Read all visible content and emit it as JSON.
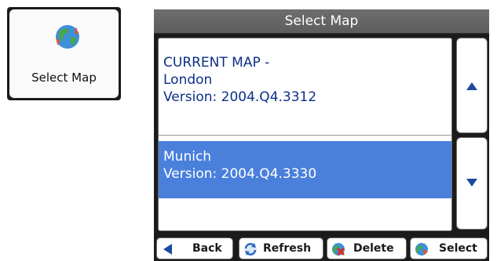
{
  "tile": {
    "label": "Select Map",
    "icon": "globe-refresh-icon"
  },
  "window": {
    "title": "Select Map"
  },
  "maps": [
    {
      "lines": [
        "CURRENT MAP -",
        "London",
        "Version:  2004.Q4.3312"
      ],
      "selected": false
    },
    {
      "lines": [
        "Munich",
        "Version:  2004.Q4.3330"
      ],
      "selected": true
    }
  ],
  "scroll": {
    "up_icon": "arrow-up-icon",
    "down_icon": "arrow-down-icon"
  },
  "toolbar": {
    "back_label": "Back",
    "refresh_label": "Refresh",
    "delete_label": "Delete",
    "select_label": "Select"
  },
  "colors": {
    "selection": "#4a80dc",
    "item_text": "#0d2f86",
    "title_bar": "#636363",
    "arrow": "#1c4aa0"
  }
}
